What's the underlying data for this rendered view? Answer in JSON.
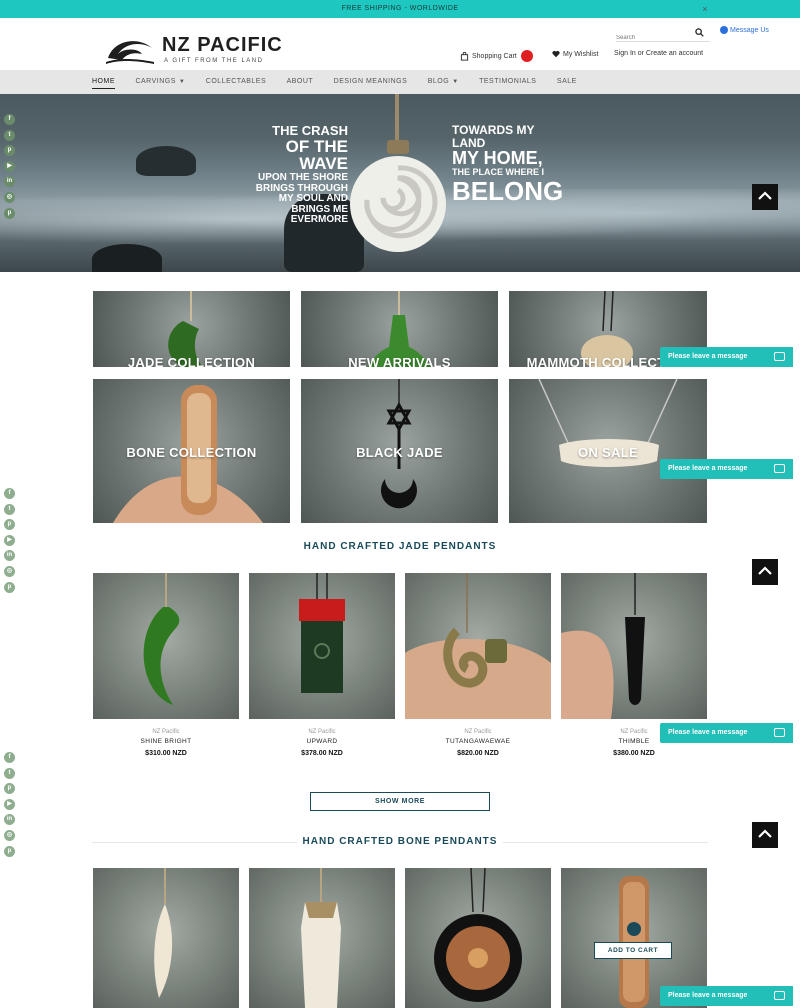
{
  "topbar": {
    "text": "FREE SHIPPING - WORLDWIDE",
    "close": "×"
  },
  "brand": {
    "name": "NZ PACIFIC",
    "tagline": "A GIFT FROM THE LAND"
  },
  "search": {
    "placeholder": "Search"
  },
  "message_us": "Message Us",
  "header_links": {
    "cart": "Shopping Cart",
    "cart_count": "",
    "wishlist": "My Wishlist",
    "signin": "Sign In or Create an account"
  },
  "nav": {
    "items": [
      {
        "label": "HOME"
      },
      {
        "label": "CARVINGS"
      },
      {
        "label": "COLLECTABLES"
      },
      {
        "label": "ABOUT"
      },
      {
        "label": "DESIGN MEANINGS"
      },
      {
        "label": "BLOG"
      },
      {
        "label": "TESTIMONIALS"
      },
      {
        "label": "SALE"
      }
    ]
  },
  "hero": {
    "left": [
      "THE CRASH",
      "OF THE WAVE",
      "UPON THE SHORE",
      "BRINGS ME EVERMORE"
    ],
    "left_small": [
      "BRINGS THROUGH",
      "MY SOUL AND"
    ],
    "right": [
      "TOWARDS MY LAND",
      "MY HOME,",
      "THE PLACE WHERE I",
      "BELONG"
    ]
  },
  "collections": [
    {
      "label": "JADE COLLECTION"
    },
    {
      "label": "NEW ARRIVALS"
    },
    {
      "label": "MAMMOTH COLLECTION"
    },
    {
      "label": "BONE COLLECTION"
    },
    {
      "label": "BLACK JADE"
    },
    {
      "label": "ON SALE"
    }
  ],
  "jade_section": {
    "title": "HAND CRAFTED JADE PENDANTS",
    "products": [
      {
        "brand": "NZ Pacific",
        "name": "SHINE BRIGHT",
        "price": "$310.00 NZD"
      },
      {
        "brand": "NZ Pacific",
        "name": "UPWARD",
        "price": "$378.00 NZD"
      },
      {
        "brand": "NZ Pacific",
        "name": "TUTANGAWAEWAE",
        "price": "$820.00 NZD"
      },
      {
        "brand": "NZ Pacific",
        "name": "THIMBLE",
        "price": "$380.00 NZD"
      }
    ],
    "show_more": "SHOW MORE"
  },
  "bone_section": {
    "title": "HAND CRAFTED BONE PENDANTS",
    "add_to_cart": "ADD TO CART"
  },
  "leave_message": "Please leave a message",
  "social_icons": [
    "facebook-icon",
    "twitter-icon",
    "pinterest-icon",
    "youtube-icon",
    "linkedin-icon",
    "instagram-icon",
    "pinterest-alt-icon"
  ],
  "social_glyphs": [
    "f",
    "t",
    "p",
    "▶",
    "in",
    "◎",
    "p"
  ],
  "colors": {
    "accent": "#1ec8c0",
    "primary": "#1a4a5a",
    "badge": "#e02020"
  }
}
